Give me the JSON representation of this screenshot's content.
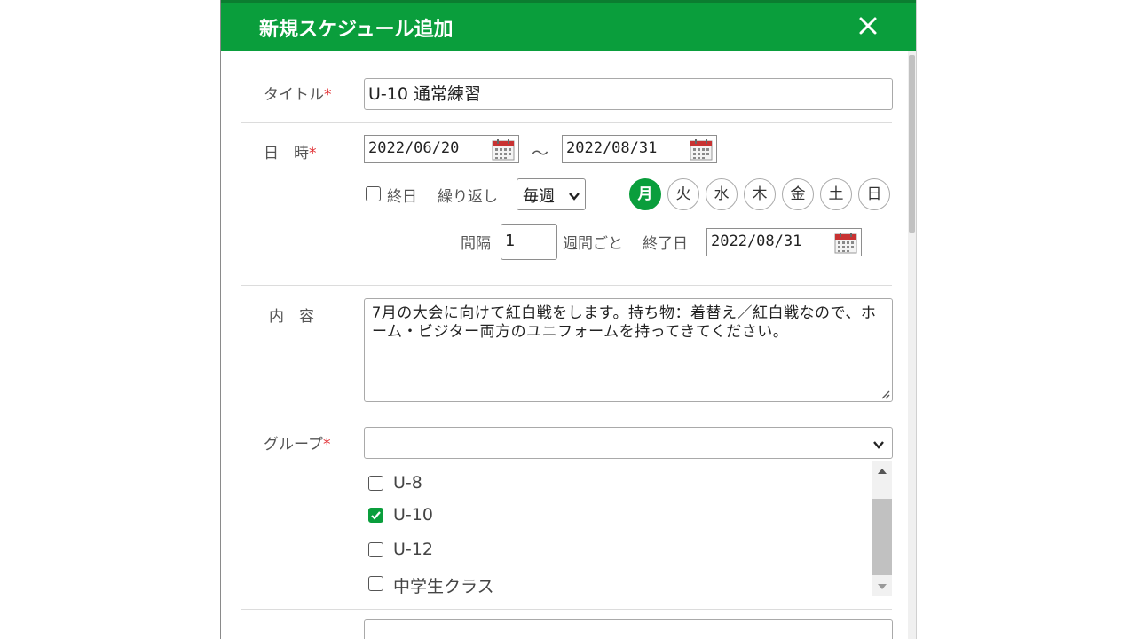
{
  "dialog": {
    "title": "新規スケジュール追加"
  },
  "title_field": {
    "label": "タイトル",
    "required_mark": "*",
    "value": "U-10 通常練習"
  },
  "datetime": {
    "label": "日　時",
    "required_mark": "*",
    "start_date": "2022/06/20",
    "separator": "～",
    "end_date": "2022/08/31",
    "all_day_label": "終日",
    "all_day_checked": false,
    "repeat_label": "繰り返し",
    "repeat_value": "毎週",
    "weekdays": [
      {
        "label": "月",
        "active": true
      },
      {
        "label": "火",
        "active": false
      },
      {
        "label": "水",
        "active": false
      },
      {
        "label": "木",
        "active": false
      },
      {
        "label": "金",
        "active": false
      },
      {
        "label": "土",
        "active": false
      },
      {
        "label": "日",
        "active": false
      }
    ],
    "interval_label": "間隔",
    "interval_value": "1",
    "interval_unit": "週間ごと",
    "end_day_label": "終了日",
    "end_day_value": "2022/08/31"
  },
  "content": {
    "label": "内　容",
    "value": "7月の大会に向けて紅白戦をします。持ち物：着替え／紅白戦なので、ホーム・ビジター両方のユニフォームを持ってきてください。"
  },
  "group": {
    "label": "グループ",
    "required_mark": "*",
    "select_value": "",
    "items": [
      {
        "label": "U-8",
        "checked": false
      },
      {
        "label": "U-10",
        "checked": true
      },
      {
        "label": "U-12",
        "checked": false
      },
      {
        "label": "中学生クラス",
        "checked": false
      }
    ]
  },
  "colors": {
    "header": "#0a9e3c",
    "accent": "#0a9e3c",
    "required": "#e0282c"
  }
}
